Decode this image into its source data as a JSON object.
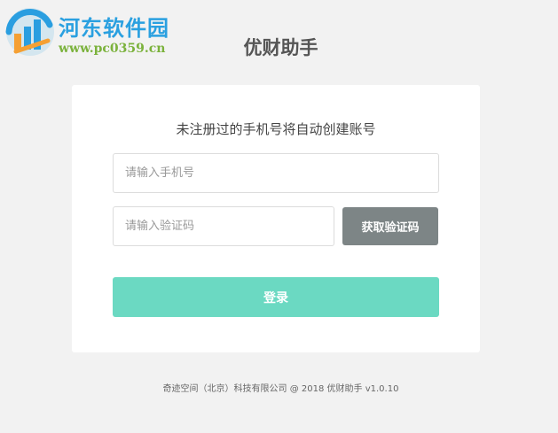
{
  "watermark": {
    "title": "河东软件园",
    "url": "www.pc0359.cn"
  },
  "app": {
    "title": "优财助手"
  },
  "login": {
    "hint": "未注册过的手机号将自动创建账号",
    "phone_placeholder": "请输入手机号",
    "phone_value": "",
    "code_placeholder": "请输入验证码",
    "code_value": "",
    "get_code_label": "获取验证码",
    "login_label": "登录"
  },
  "footer": {
    "text": "奇迹空间（北京）科技有限公司 @ 2018 优财助手 v1.0.10"
  },
  "colors": {
    "background": "#f2f2f2",
    "card": "#ffffff",
    "get_code_button": "#7d8586",
    "login_button": "#6bd9c2",
    "watermark_title": "#2aa0e0",
    "watermark_url": "#7bb23c"
  },
  "icons": {
    "watermark_logo": "bar-chart-logo-icon"
  }
}
